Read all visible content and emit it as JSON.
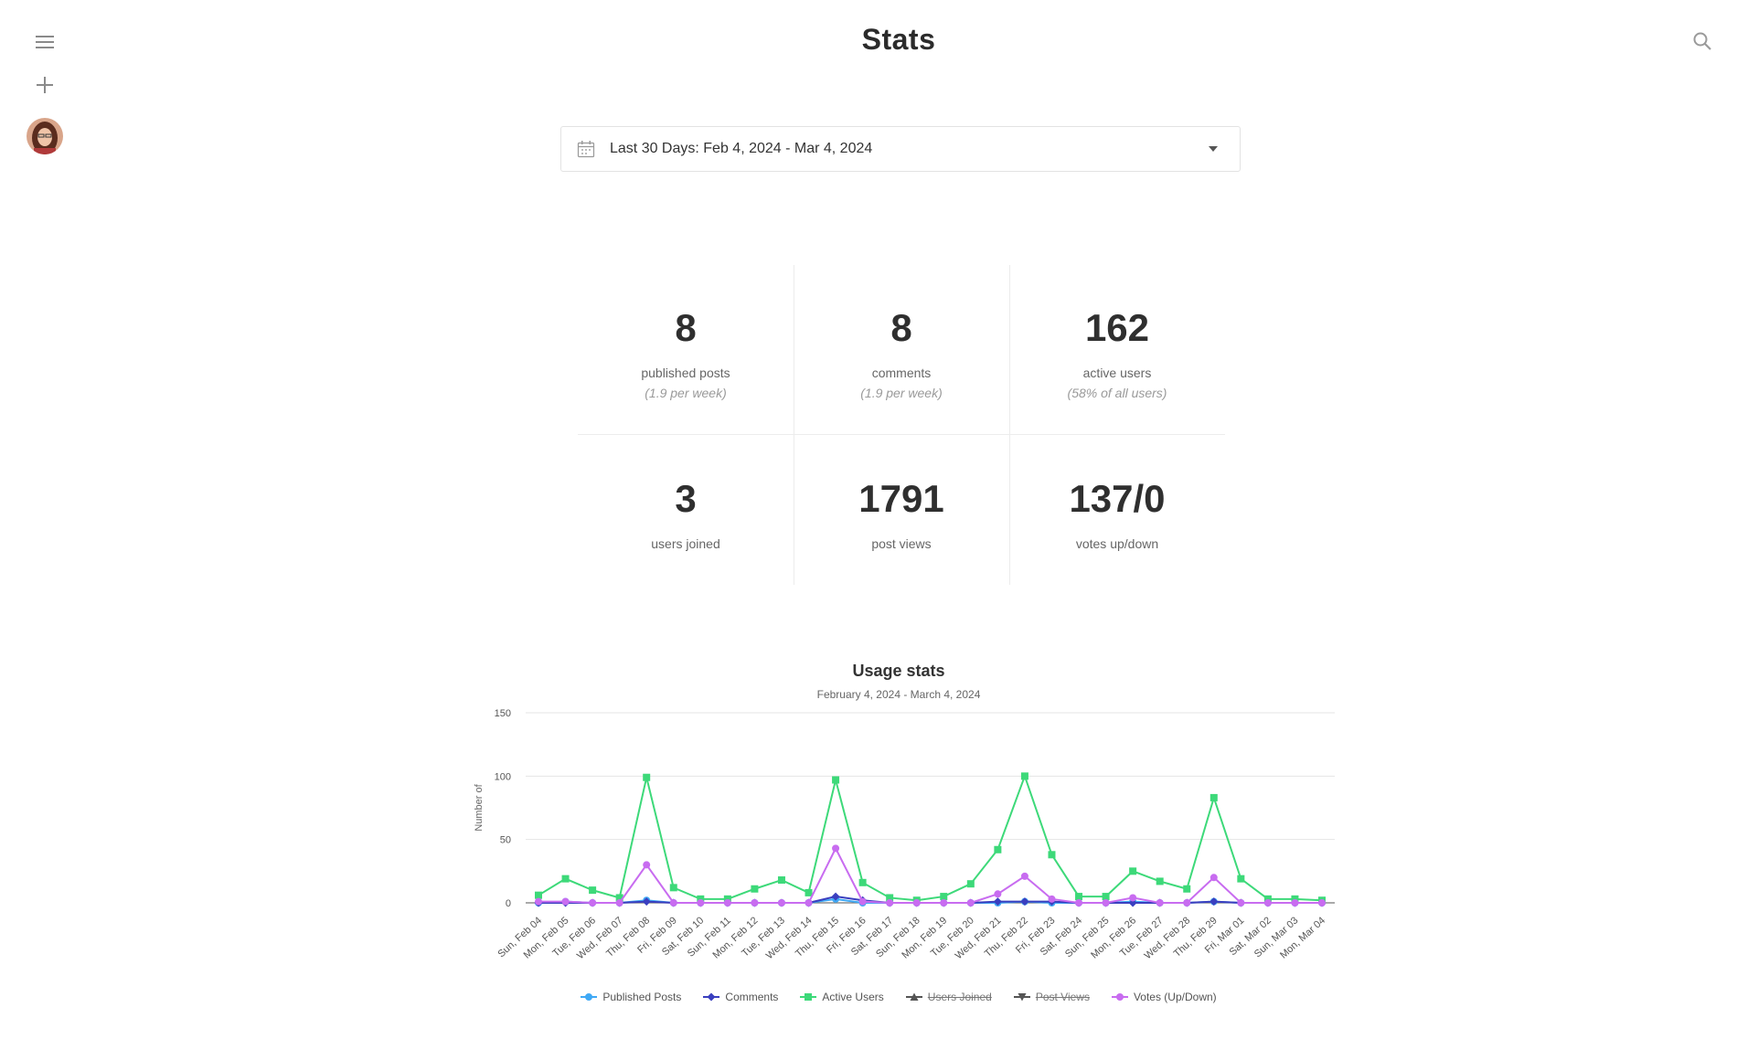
{
  "header": {
    "title": "Stats"
  },
  "date_picker": {
    "label": "Last 30 Days: Feb 4, 2024 - Mar 4, 2024"
  },
  "stats": [
    {
      "value": "8",
      "label": "published posts",
      "sub": "(1.9 per week)"
    },
    {
      "value": "8",
      "label": "comments",
      "sub": "(1.9 per week)"
    },
    {
      "value": "162",
      "label": "active users",
      "sub": "(58% of all users)"
    },
    {
      "value": "3",
      "label": "users joined",
      "sub": ""
    },
    {
      "value": "1791",
      "label": "post views",
      "sub": ""
    },
    {
      "value": "137/0",
      "label": "votes up/down",
      "sub": ""
    }
  ],
  "chart_data": {
    "type": "line",
    "title": "Usage stats",
    "subtitle": "February 4, 2024 - March 4, 2024",
    "ylabel": "Number of",
    "ylim": [
      0,
      150
    ],
    "yticks": [
      0,
      50,
      100,
      150
    ],
    "categories": [
      "Sun, Feb 04",
      "Mon, Feb 05",
      "Tue, Feb 06",
      "Wed, Feb 07",
      "Thu, Feb 08",
      "Fri, Feb 09",
      "Sat, Feb 10",
      "Sun, Feb 11",
      "Mon, Feb 12",
      "Tue, Feb 13",
      "Wed, Feb 14",
      "Thu, Feb 15",
      "Fri, Feb 16",
      "Sat, Feb 17",
      "Sun, Feb 18",
      "Mon, Feb 19",
      "Tue, Feb 20",
      "Wed, Feb 21",
      "Thu, Feb 22",
      "Fri, Feb 23",
      "Sat, Feb 24",
      "Sun, Feb 25",
      "Mon, Feb 26",
      "Tue, Feb 27",
      "Wed, Feb 28",
      "Thu, Feb 29",
      "Fri, Mar 01",
      "Sat, Mar 02",
      "Sun, Mar 03",
      "Mon, Mar 04"
    ],
    "grid": true,
    "legend_position": "bottom",
    "series": [
      {
        "name": "Published Posts",
        "color": "#3fa9f5",
        "marker": "circle",
        "visible": true,
        "values": [
          0,
          1,
          0,
          0,
          2,
          0,
          0,
          0,
          0,
          0,
          0,
          3,
          0,
          0,
          0,
          0,
          0,
          0,
          1,
          0,
          0,
          0,
          1,
          0,
          0,
          1,
          0,
          0,
          0,
          0
        ]
      },
      {
        "name": "Comments",
        "color": "#3a3fbf",
        "marker": "diamond",
        "visible": true,
        "values": [
          0,
          0,
          0,
          0,
          1,
          0,
          0,
          0,
          0,
          0,
          0,
          5,
          2,
          0,
          0,
          0,
          0,
          1,
          1,
          1,
          0,
          0,
          0,
          0,
          0,
          1,
          0,
          0,
          0,
          0
        ]
      },
      {
        "name": "Active Users",
        "color": "#3dd979",
        "marker": "square",
        "visible": true,
        "values": [
          6,
          19,
          10,
          4,
          99,
          12,
          3,
          3,
          11,
          18,
          8,
          97,
          16,
          4,
          2,
          5,
          15,
          42,
          100,
          38,
          5,
          5,
          25,
          17,
          11,
          83,
          19,
          3,
          3,
          2
        ]
      },
      {
        "name": "Users Joined",
        "color": "#555555",
        "marker": "triangle",
        "visible": false,
        "values": []
      },
      {
        "name": "Post Views",
        "color": "#555555",
        "marker": "triangle-down",
        "visible": false,
        "values": []
      },
      {
        "name": "Votes (Up/Down)",
        "color": "#c86cf0",
        "marker": "circle",
        "visible": true,
        "values": [
          1,
          1,
          0,
          0,
          30,
          0,
          0,
          0,
          0,
          0,
          0,
          43,
          1,
          0,
          0,
          0,
          0,
          7,
          21,
          3,
          0,
          0,
          4,
          0,
          0,
          20,
          0,
          0,
          0,
          0
        ]
      }
    ]
  }
}
